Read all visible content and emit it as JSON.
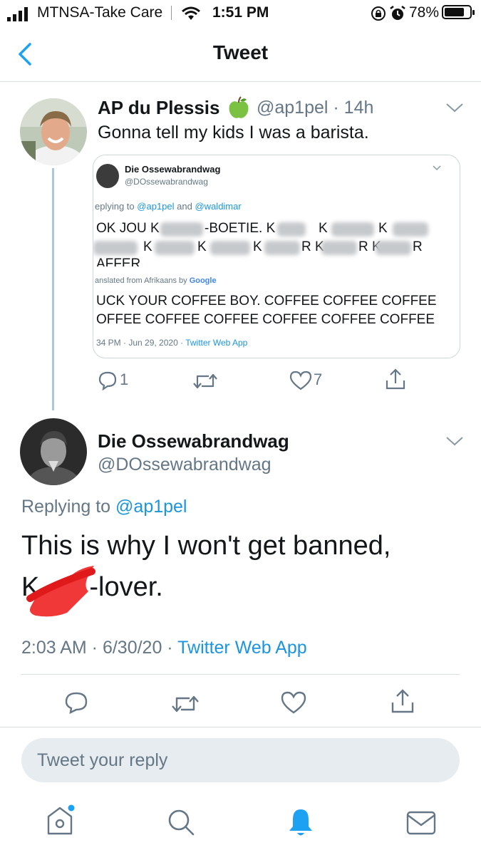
{
  "status_bar": {
    "carrier": "MTNSA-Take Care",
    "time": "1:51 PM",
    "battery": "78%"
  },
  "header": {
    "title": "Tweet"
  },
  "tweet1": {
    "name": "AP du Plessis",
    "handle": "@ap1pel",
    "age": "· 14h",
    "text": "Gonna tell my kids I was a barista.",
    "reply_count": "1",
    "like_count": "7"
  },
  "quoted": {
    "name": "Die Ossewabrandwag",
    "handle": "@DOssewabrandwag",
    "replying_prefix": "eplying to",
    "replying_user1": "@ap1pel",
    "replying_and": "and",
    "replying_user2": "@waldimar",
    "line1_a": "OK JOU K",
    "line1_b": "-BOETIE. K",
    "line1_c": "K",
    "line1_d": "K",
    "line2_a": "K",
    "line2_b": "K",
    "line2_c": "K",
    "line2_d": "R K",
    "line2_e": "R K",
    "line2_f": "R",
    "line3": "AFFER",
    "translated_prefix": "anslated from Afrikaans by",
    "translated_brand": "Google",
    "translation_line1": "UCK YOUR COFFEE BOY. COFFEE COFFEE COFFEE",
    "translation_line2": "OFFEE COFFEE COFFEE COFFEE COFFEE COFFEE",
    "meta_time": "34 PM · Jun 29, 2020 ·",
    "meta_app": "Twitter Web App"
  },
  "tweet2": {
    "name": "Die Ossewabrandwag",
    "handle": "@DOssewabrandwag",
    "replying_prefix": "Replying to",
    "replying_user": "@ap1pel",
    "text_line1": "This is why I won't get banned,",
    "text_line2_start": "K",
    "text_line2_end": "-lover.",
    "timestamp": "2:03 AM · 6/30/20 ·",
    "source": "Twitter Web App"
  },
  "reply_box": {
    "placeholder": "Tweet your reply"
  },
  "colors": {
    "link": "#1b95e0",
    "secondary": "#657786",
    "notification_active": "#1da1f2"
  }
}
